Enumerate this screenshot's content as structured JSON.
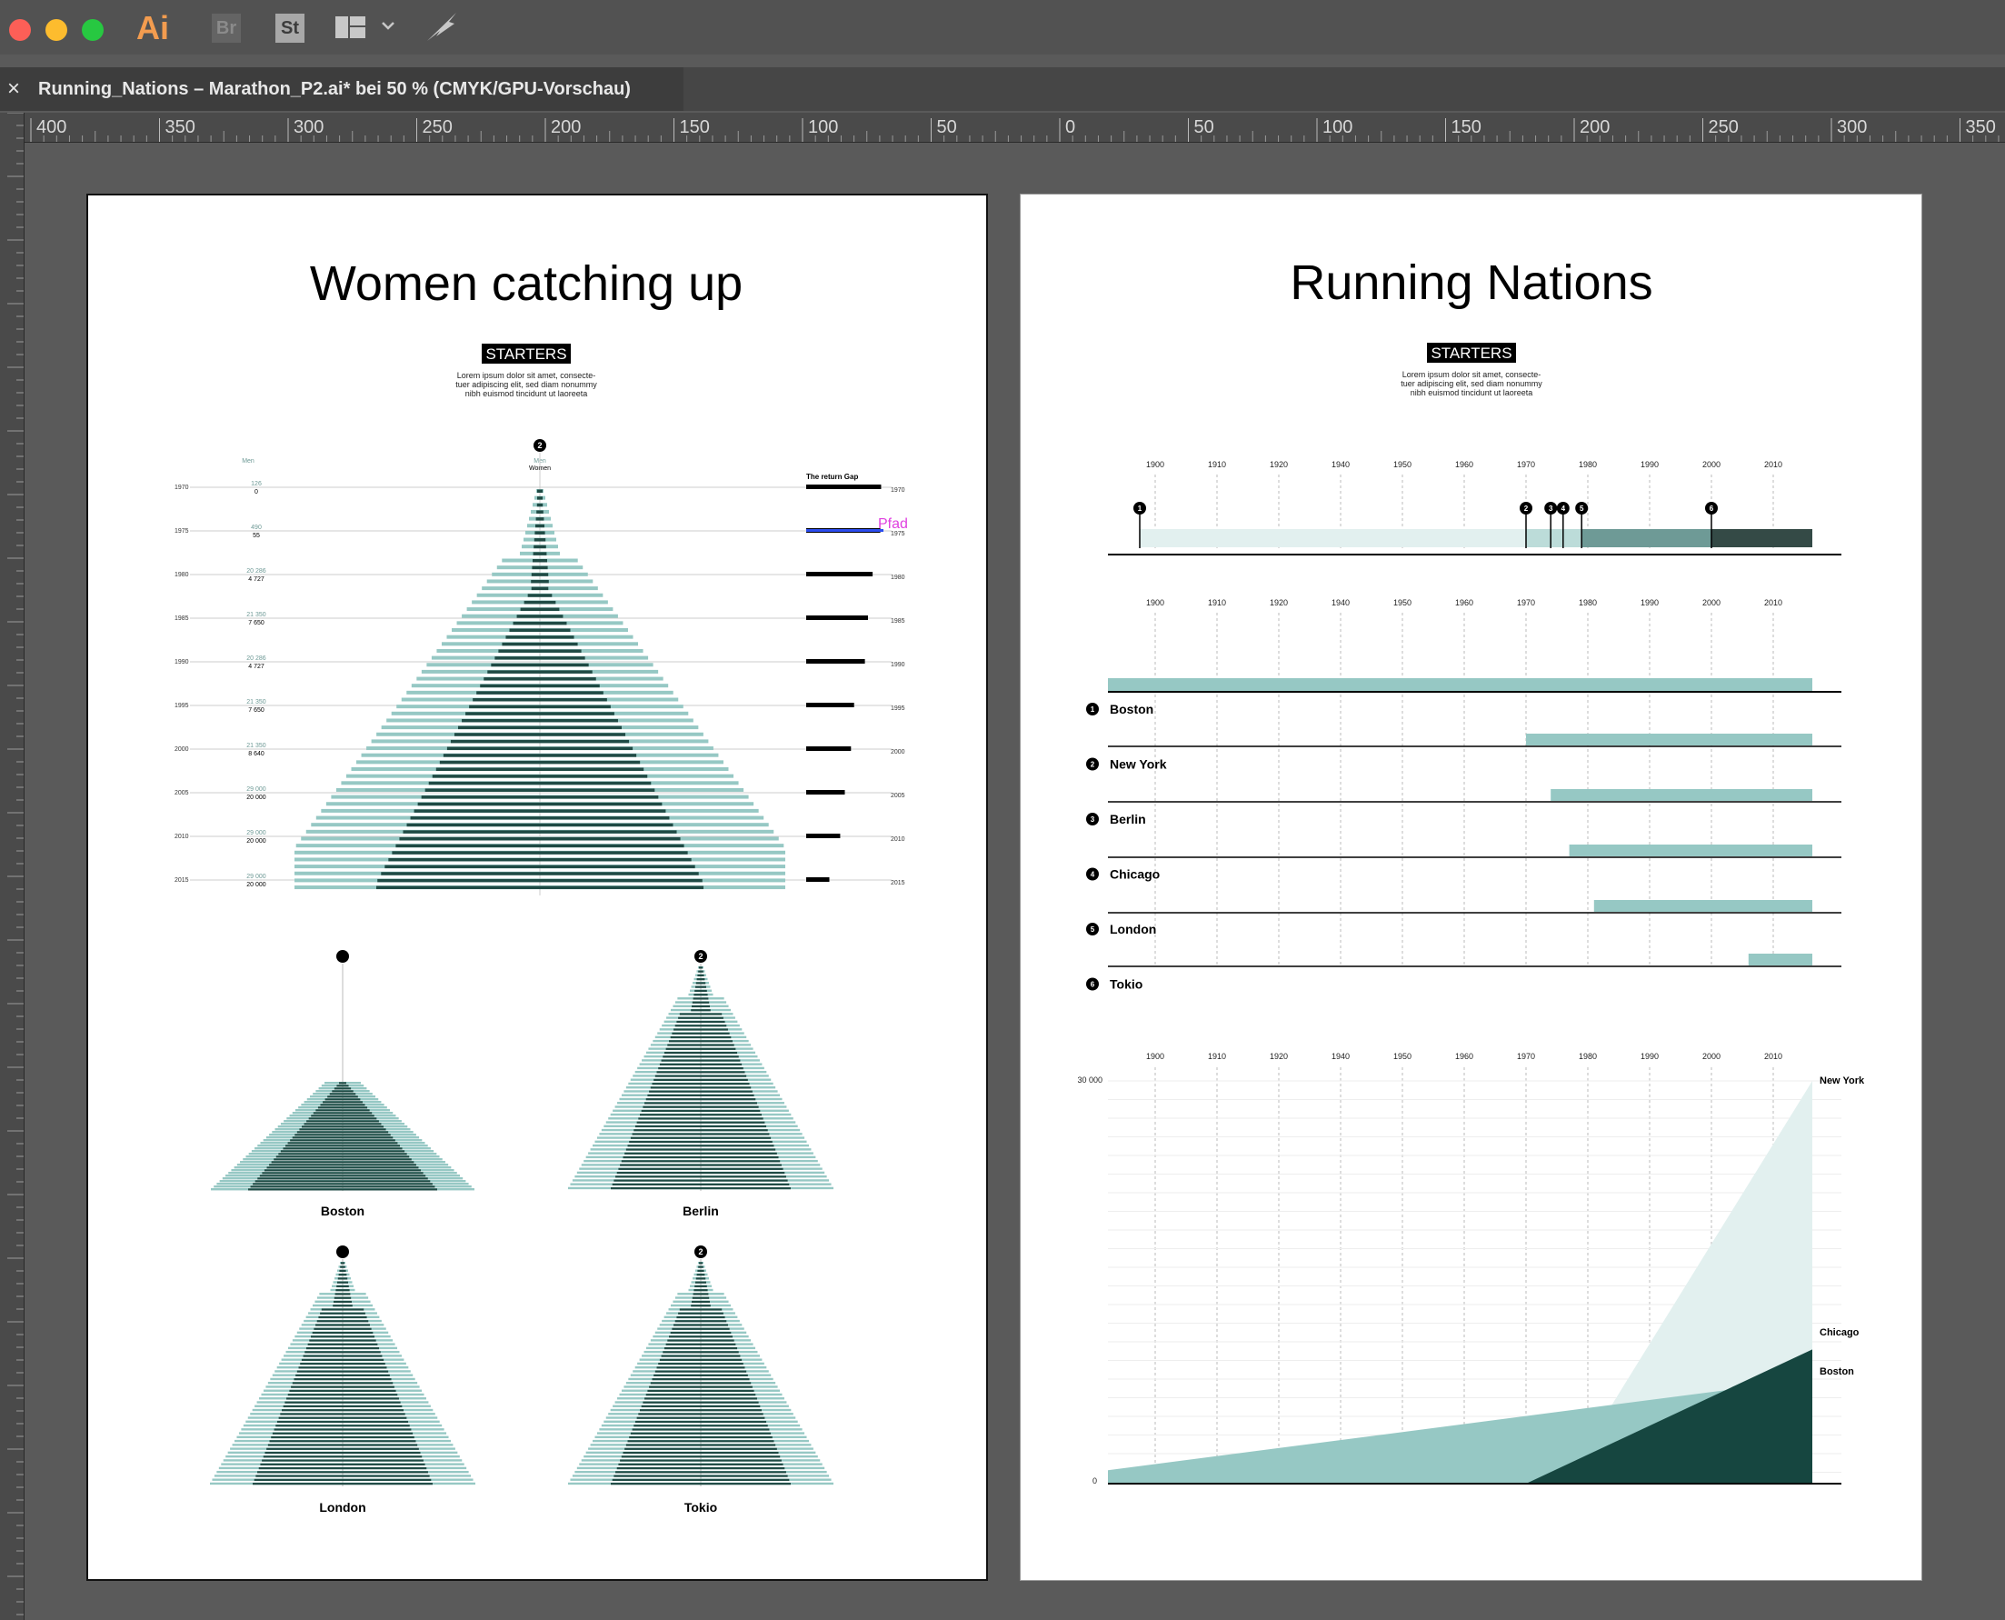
{
  "app": {
    "icons": [
      "close-light",
      "minimize-light",
      "zoom-light",
      "illustrator-icon",
      "bridge-icon",
      "stock-icon",
      "workspace-icon",
      "chevron-down-icon",
      "publish-icon"
    ],
    "icon_labels": {
      "ai": "Ai",
      "br": "Br",
      "st": "St"
    },
    "colors": {
      "close": "#fc5f57",
      "minimize": "#fdbc2e",
      "zoom": "#27c841",
      "ai": "#f39c4f"
    }
  },
  "tab": {
    "close_glyph": "×",
    "title": "Running_Nations – Marathon_P2.ai* bei 50 % (CMYK/GPU-Vorschau)"
  },
  "ruler": {
    "top_labels": [
      "400",
      "350",
      "300",
      "250",
      "200",
      "150",
      "100",
      "50",
      "0",
      "50",
      "100",
      "150",
      "200",
      "250",
      "300",
      "350"
    ]
  },
  "colors": {
    "light": "#96c8c4",
    "dark": "#1f4a44",
    "pale": "#e2f0ef",
    "mid": "#6e9a96",
    "darkest": "#344a46",
    "deep": "#164640"
  },
  "left_artboard": {
    "title": "Women catching up",
    "starters_label": "STARTERS",
    "intro": [
      "Lorem ipsum dolor sit amet, consecte-",
      "tuer adipiscing elit, sed diam nonummy",
      "nibh euismod tincidunt ut laoreeta"
    ],
    "marker": "2",
    "header_men": "Men",
    "header_men_center": "Men",
    "header_women": "Women",
    "return_gap_label": "The return Gap",
    "selection_label": "Pfad",
    "years": [
      "1970",
      "1975",
      "1980",
      "1985",
      "1990",
      "1995",
      "2000",
      "2005",
      "2010",
      "2015"
    ],
    "men_values": [
      "126",
      "490",
      "20 286",
      "21 350",
      "20 286",
      "21 350",
      "21 350",
      "29 000",
      "29 000",
      "29 000"
    ],
    "women_values": [
      "0",
      "55",
      "4 727",
      "7 650",
      "4 727",
      "7 650",
      "8 640",
      "20 000",
      "20 000",
      "20 000"
    ],
    "gap_fraction": [
      0.97,
      0.96,
      0.86,
      0.8,
      0.76,
      0.62,
      0.58,
      0.5,
      0.44,
      0.3
    ],
    "small_multiples": [
      {
        "city": "Boston",
        "marker": ""
      },
      {
        "city": "Berlin",
        "marker": "2"
      },
      {
        "city": "London",
        "marker": ""
      },
      {
        "city": "Tokio",
        "marker": "2"
      }
    ]
  },
  "right_artboard": {
    "title": "Running Nations",
    "starters_label": "STARTERS",
    "intro": [
      "Lorem ipsum dolor sit amet, consecte-",
      "tuer adipiscing elit, sed diam nonummy",
      "nibh euismod tincidunt ut laoreeta"
    ],
    "decades": [
      "1900",
      "1910",
      "1920",
      "1940",
      "1950",
      "1960",
      "1970",
      "1980",
      "1990",
      "2000",
      "2010"
    ],
    "markers": [
      "1",
      "2",
      "3",
      "4",
      "5",
      "6"
    ],
    "marker_years": [
      1897,
      1970,
      1974,
      1976,
      1979,
      2000
    ],
    "cities": [
      {
        "number": "1",
        "name": "Boston",
        "start": 1897
      },
      {
        "number": "2",
        "name": "New York",
        "start": 1970
      },
      {
        "number": "3",
        "name": "Berlin",
        "start": 1974
      },
      {
        "number": "4",
        "name": "Chicago",
        "start": 1977
      },
      {
        "number": "5",
        "name": "London",
        "start": 1981
      },
      {
        "number": "6",
        "name": "Tokio",
        "start": 2006
      }
    ],
    "area_y_top": "30 000",
    "area_y_bottom": "0",
    "area_labels": [
      "New York",
      "Chicago",
      "Boston"
    ]
  },
  "chart_data": {
    "type": "area",
    "ylim": [
      0,
      30000
    ],
    "x": [
      1897,
      1970,
      1977,
      2021
    ],
    "series": [
      {
        "name": "New York",
        "values": [
          null,
          0,
          1000,
          30000
        ]
      },
      {
        "name": "Boston",
        "values": [
          1000,
          null,
          null,
          8000
        ]
      },
      {
        "name": "Chicago",
        "values": [
          null,
          0,
          null,
          10000
        ]
      }
    ],
    "tick_labels": [
      "1900",
      "1910",
      "1920",
      "1940",
      "1950",
      "1960",
      "1970",
      "1980",
      "1990",
      "2000",
      "2010"
    ]
  }
}
